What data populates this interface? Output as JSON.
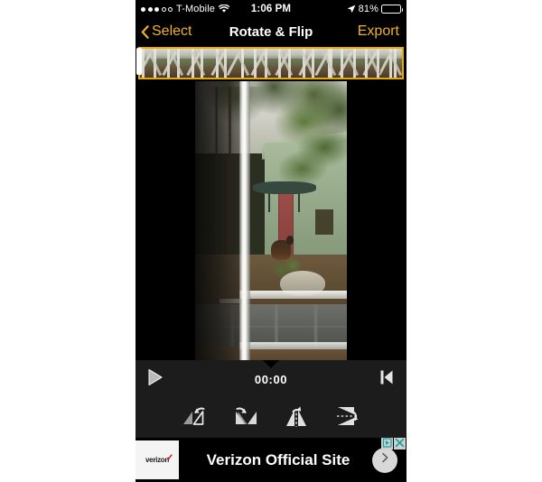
{
  "status_bar": {
    "signal_dots_filled": 3,
    "signal_dots_total": 5,
    "carrier": "T-Mobile",
    "wifi_icon": "wifi-icon",
    "time": "1:06 PM",
    "location_icon": "location-arrow-icon",
    "battery_percent": "81%",
    "battery_level": 81,
    "battery_icon": "battery-icon"
  },
  "nav_bar": {
    "back_icon": "chevron-left-icon",
    "back_label": "Select",
    "title": "Rotate & Flip",
    "export_label": "Export",
    "accent_color": "#f0b323"
  },
  "filmstrip": {
    "border_color": "#e9a900",
    "frame_count": 12,
    "playhead_handle": "trim-handle-left"
  },
  "preview": {
    "description": "video-preview-frame"
  },
  "transport": {
    "play_icon": "play-icon",
    "skip_to_start_icon": "skip-to-start-icon",
    "time": "00:00",
    "marker_icon": "playhead-marker-icon"
  },
  "tools": [
    {
      "name": "rotate-left-button",
      "icon": "rotate-left-icon"
    },
    {
      "name": "rotate-right-button",
      "icon": "rotate-right-icon"
    },
    {
      "name": "flip-horizontal-button",
      "icon": "flip-horizontal-icon"
    },
    {
      "name": "flip-vertical-button",
      "icon": "flip-vertical-icon"
    }
  ],
  "ad": {
    "logo_text": "verizon",
    "headline": "Verizon Official Site",
    "cta_icon": "chevron-right-icon",
    "adchoices_icon": "adchoices-icon",
    "close_icon": "close-icon",
    "badge_color": "#1aa3a3",
    "logo_accent_color": "#cd040b"
  }
}
